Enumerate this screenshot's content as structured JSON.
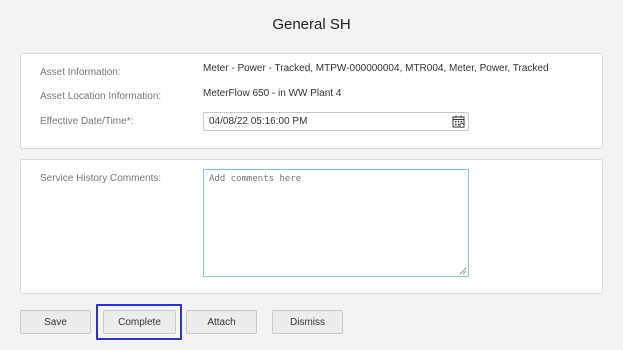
{
  "page": {
    "title": "General SH"
  },
  "info": {
    "asset_label": "Asset Information:",
    "asset_value": "Meter - Power - Tracked, MTPW-000000004, MTR004, Meter, Power, Tracked",
    "location_label": "Asset Location Information:",
    "location_value": "MeterFlow 650 - in WW Plant 4",
    "date_label": "Effective Date/Time*:",
    "date_value": "04/08/22 05:16:00 PM"
  },
  "comments": {
    "label": "Service History Comments:",
    "placeholder": "Add comments here"
  },
  "buttons": {
    "save": "Save",
    "complete": "Complete",
    "attach": "Attach",
    "dismiss": "Dismiss"
  },
  "icons": {
    "date_picker": "calendar-icon",
    "resize": "resize-grip-icon"
  },
  "colors": {
    "highlight": "#2d36b3",
    "textarea_border": "#8ec3df"
  }
}
